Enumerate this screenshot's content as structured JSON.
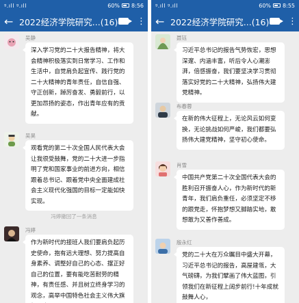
{
  "left": {
    "status": {
      "signal": "ᵍ.ıll ᵍ.ıll",
      "battery": "60%",
      "time": "8:56"
    },
    "header": {
      "title": "2022经济学院研究...(16)"
    },
    "messages": [
      {
        "name": "吴静",
        "text": "深入学习党的二十大报告精神，将大会精神积极落实到日常学习、工作和生活中，自觉肩负起宣传、践行党的二十大精神的青年责任，自信自强、守正创新，踔厉奋发、勇毅前行，以更加昂扬的姿态，作出青年应有的贡献。"
      },
      {
        "name": "吴昊",
        "text": "观看党的第二十次全国人民代表大会让我很受鼓舞，党的二十大进一步指明了党和国家事业的前进方向，相信跟着总书记、跟着党中央全面建成社会主义现代化强国的目标一定能如快实现。"
      },
      {
        "name": "冯婷",
        "text": "作为新时代的接班人我们要肩负起历史使命，抱有远大理想、努力提高自身素养、调整好自己的心态、摆正好自己的位置，要有能吃苦耐劳的精神，有责任感、并且树立终身学习的观念，高举中国特色社会主义伟大旗帜，奋"
      }
    ],
    "system_notice": "冯婷撤回了一条消息"
  },
  "right": {
    "status": {
      "signal": "ᵍ.ıll ᵍ.ıll",
      "battery": "60%",
      "time": "8:55"
    },
    "header": {
      "title": "2022经济学院研究...(16)"
    },
    "messages": [
      {
        "name": "聂钰",
        "text": "习近平总书记的报告气势恢宏，思想深邃、内涵丰富，听后令人心潮澎湃，倍感振奋，我们要坚决学习贯彻落实好党的二十大精神，弘扬伟大建党精神。"
      },
      {
        "name": "布春蓉",
        "text": "在新的伟大征程上，无论风云如何变换，无论挑战如何严峻，我们都要弘扬伟大建党精神，坚守初心使命。"
      },
      {
        "name": "肖雪",
        "text": "中国共产党第二十次全国代表大会的胜利召开振奋人心，作为新时代的新青年，我们肩负重任，必须坚定不移的跟党走，怀抱梦想又脚踏实地，敢想敢为又善作善成。"
      },
      {
        "name": "殷永红",
        "text": "党的二十大在万众瞩目中盛大开幕，习近平总书记的报告，高屋建瓴，大气磅礴，为我们擘画了伟大蓝图，引领我们在新征程上阔步前行!十年成就鼓舞人心，"
      }
    ]
  },
  "colors": {
    "header": "#1f5fa8",
    "background": "#ededed",
    "bubble": "#ffffff"
  },
  "icons": [
    "back-arrow-icon",
    "video-call-icon",
    "more-icon"
  ]
}
